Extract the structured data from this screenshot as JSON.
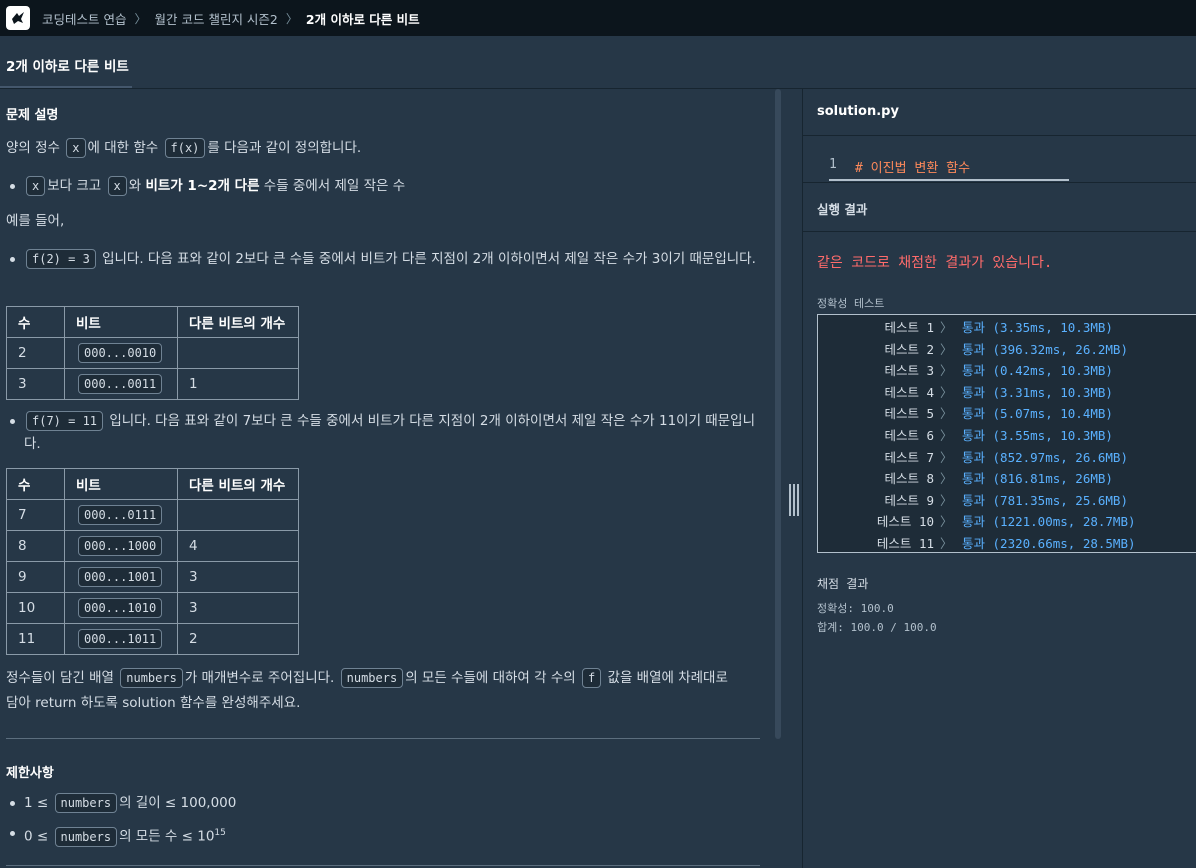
{
  "nav": {
    "breadcrumb": [
      "코딩테스트 연습",
      "월간 코드 챌린지 시즌2",
      "2개 이하로 다른 비트"
    ]
  },
  "title": "2개 이하로 다른 비트",
  "problem": {
    "heading": "문제 설명",
    "intro": [
      "양의 정수",
      "x",
      "에 대한 함수",
      "f(x)",
      "를 다음과 같이 정의합니다."
    ],
    "rule": [
      "x",
      "보다 크고",
      "x",
      "와",
      "비트가 1~2개 다른",
      "수들 중에서 제일 작은 수"
    ],
    "example_label": "예를 들어,",
    "ex1": [
      "f(2) = 3",
      "입니다. 다음 표와 같이 2보다 큰 수들 중에서 비트가 다른 지점이 2개 이하이면서 제일 작은 수가 3이기 때문입니다."
    ],
    "table_headers": [
      "수",
      "비트",
      "다른 비트의 개수"
    ],
    "table1": [
      {
        "n": "2",
        "bits": "000...0010",
        "diff": ""
      },
      {
        "n": "3",
        "bits": "000...0011",
        "diff": "1"
      }
    ],
    "ex2": [
      "f(7) = 11",
      "입니다. 다음 표와 같이 7보다 큰 수들 중에서 비트가 다른 지점이 2개 이하이면서 제일 작은 수가 11이기 때문입니다."
    ],
    "table2": [
      {
        "n": "7",
        "bits": "000...0111",
        "diff": ""
      },
      {
        "n": "8",
        "bits": "000...1000",
        "diff": "4"
      },
      {
        "n": "9",
        "bits": "000...1001",
        "diff": "3"
      },
      {
        "n": "10",
        "bits": "000...1010",
        "diff": "3"
      },
      {
        "n": "11",
        "bits": "000...1011",
        "diff": "2"
      }
    ],
    "task": [
      "정수들이 담긴 배열",
      "numbers",
      "가 매개변수로 주어집니다.",
      "numbers",
      "의 모든 수들에 대하여 각 수의",
      "f",
      "값을 배열에 차례대로",
      "담아 return 하도록 solution 함수를 완성해주세요."
    ]
  },
  "constraints": {
    "heading": "제한사항",
    "c1": [
      "1 ≤",
      "numbers",
      "의 길이 ≤ 100,000"
    ],
    "c2": [
      "0 ≤",
      "numbers",
      "의 모든 수 ≤ 10",
      "15"
    ]
  },
  "editor": {
    "filename": "solution.py",
    "line_number": "1",
    "comment": "# 이진법 변환 함수"
  },
  "run": {
    "heading": "실행 결과",
    "warning": "같은 코드로 채점한 결과가 있습니다.",
    "accuracy_label": "정확성  테스트",
    "tests": [
      {
        "name": "테스트 1",
        "result": "통과 (3.35ms, 10.3MB)"
      },
      {
        "name": "테스트 2",
        "result": "통과 (396.32ms, 26.2MB)"
      },
      {
        "name": "테스트 3",
        "result": "통과 (0.42ms, 10.3MB)"
      },
      {
        "name": "테스트 4",
        "result": "통과 (3.31ms, 10.3MB)"
      },
      {
        "name": "테스트 5",
        "result": "통과 (5.07ms, 10.4MB)"
      },
      {
        "name": "테스트 6",
        "result": "통과 (3.55ms, 10.3MB)"
      },
      {
        "name": "테스트 7",
        "result": "통과 (852.97ms, 26.6MB)"
      },
      {
        "name": "테스트 8",
        "result": "통과 (816.81ms, 26MB)"
      },
      {
        "name": "테스트 9",
        "result": "통과 (781.35ms, 25.6MB)"
      },
      {
        "name": "테스트 10",
        "result": "통과 (1221.00ms, 28.7MB)"
      },
      {
        "name": "테스트 11",
        "result": "통과 (2320.66ms, 28.5MB)"
      }
    ],
    "grading_label": "채점 결과",
    "accuracy_score": "정확성: 100.0",
    "total_score": "합계: 100.0 / 100.0"
  },
  "colors": {
    "pass": "#5ab1ff",
    "warning": "#ff6b6b",
    "comment": "#ff8a5b",
    "background": "#263747"
  }
}
